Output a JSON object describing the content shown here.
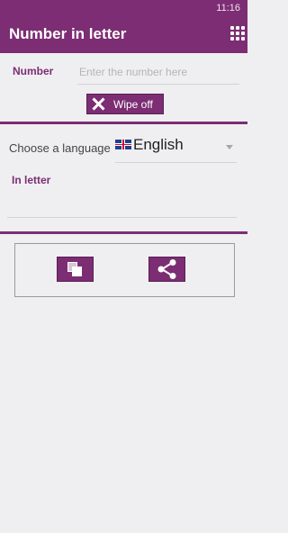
{
  "status_bar": {
    "time": "11:16"
  },
  "app_bar": {
    "title": "Number in letter",
    "menu_icon": "grid-icon"
  },
  "number_field": {
    "label": "Number",
    "placeholder": "Enter the number here",
    "value": ""
  },
  "wipe_button": {
    "label": "Wipe off",
    "icon": "close-icon"
  },
  "language": {
    "label": "Choose a language",
    "selected": "English",
    "flag_icon": "uk-flag-icon"
  },
  "output": {
    "label": "In letter",
    "value": ""
  },
  "actions": {
    "copy_icon": "copy-icon",
    "share_icon": "share-icon"
  },
  "colors": {
    "primary": "#7c2d73",
    "background": "#efeff1"
  }
}
